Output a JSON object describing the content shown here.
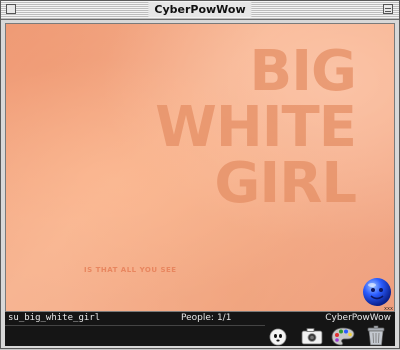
{
  "window": {
    "title": "CyberPowWow"
  },
  "canvas": {
    "headline": [
      "BIG",
      "WHITE",
      "GIRL"
    ],
    "tagline": "IS THAT ALL YOU SEE"
  },
  "statusbar": {
    "channel_name": "su_big_white_girl",
    "people_label": "People:",
    "people_value": "1/1",
    "app_name": "CyberPowWow"
  },
  "tools": [
    {
      "name": "avatar-ghost-icon"
    },
    {
      "name": "camera-icon"
    },
    {
      "name": "paint-palette-icon"
    },
    {
      "name": "trash-can-icon"
    }
  ],
  "avatar": {
    "name": "blue-ball-avatar-icon"
  },
  "colors": {
    "canvas_peach": "#f5ae8c",
    "headline": "#e58f65",
    "statusbar_bg": "#151515",
    "avatar_blue": "#2a5cff"
  }
}
